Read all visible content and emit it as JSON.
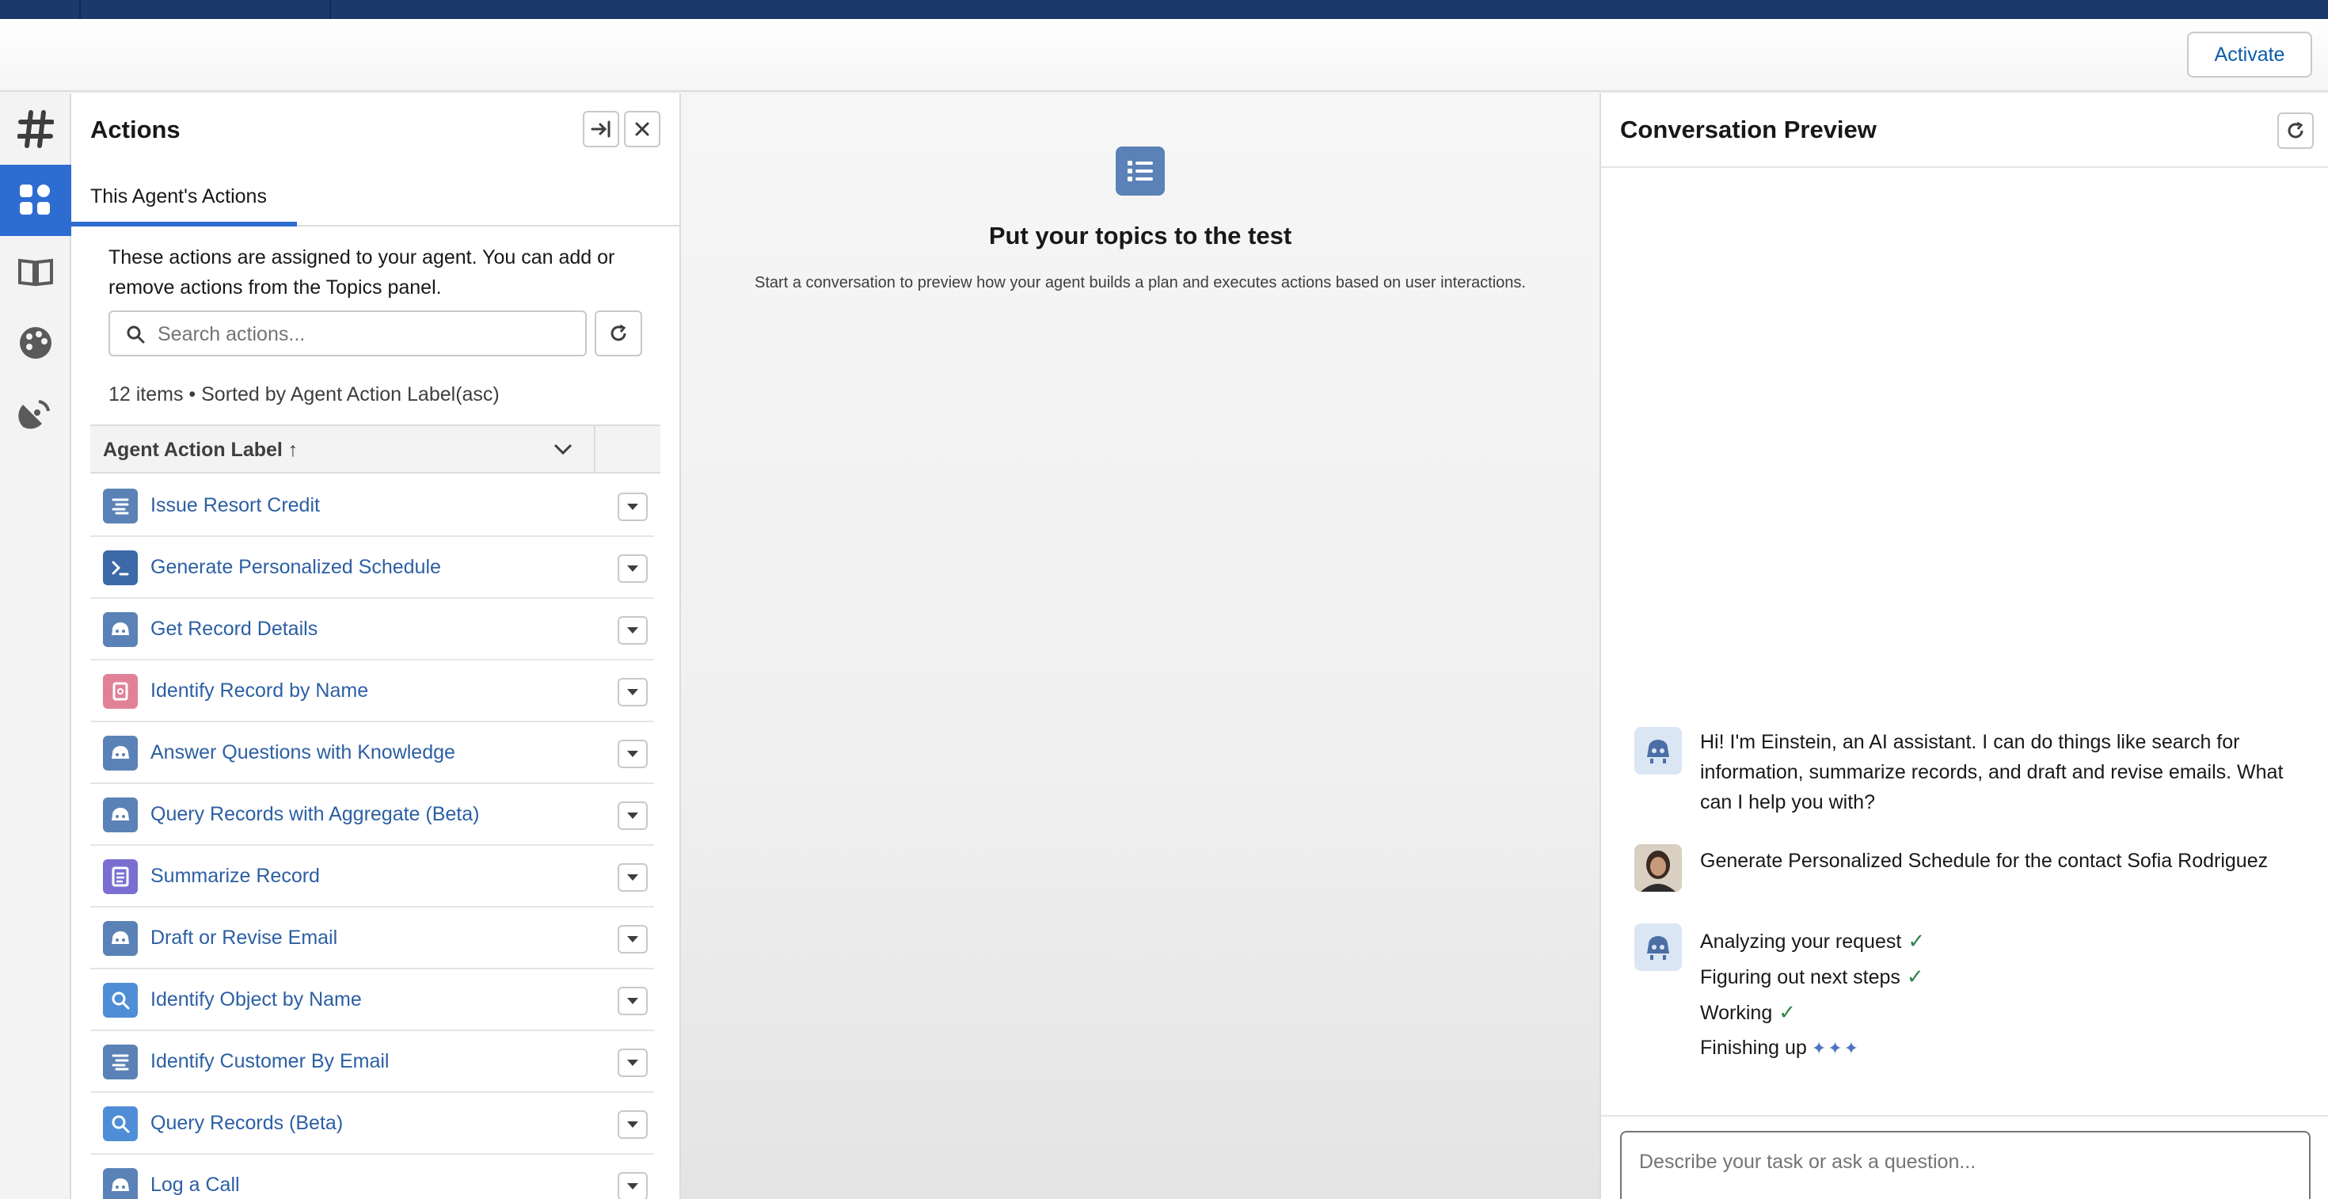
{
  "header": {
    "activate_label": "Activate"
  },
  "rail": {
    "items": [
      {
        "icon": "hash-icon",
        "active": false
      },
      {
        "icon": "grid-icon",
        "active": true
      },
      {
        "icon": "book-icon",
        "active": false
      },
      {
        "icon": "palette-icon",
        "active": false
      },
      {
        "icon": "satellite-icon",
        "active": false
      }
    ]
  },
  "actions": {
    "title": "Actions",
    "tab_label": "This Agent's Actions",
    "description": "These actions are assigned to your agent. You can add or remove actions from the Topics panel.",
    "search_placeholder": "Search actions...",
    "count_text": "12 items • Sorted by Agent Action Label(asc)",
    "column_header": "Agent Action Label ↑",
    "rows": [
      {
        "label": "Issue Resort Credit",
        "icon": "flow-icon",
        "color": "#5b82b6"
      },
      {
        "label": "Generate Personalized Schedule",
        "icon": "prompt-icon",
        "color": "#3c6aa8"
      },
      {
        "label": "Get Record Details",
        "icon": "einstein-icon",
        "color": "#5b82b6"
      },
      {
        "label": "Identify Record by Name",
        "icon": "record-icon",
        "color": "#e08198"
      },
      {
        "label": "Answer Questions with Knowledge",
        "icon": "einstein-icon",
        "color": "#5b82b6"
      },
      {
        "label": "Query Records with Aggregate (Beta)",
        "icon": "einstein-icon",
        "color": "#5b82b6"
      },
      {
        "label": "Summarize Record",
        "icon": "summary-icon",
        "color": "#7a6fd1"
      },
      {
        "label": "Draft or Revise Email",
        "icon": "einstein-icon",
        "color": "#5b82b6"
      },
      {
        "label": "Identify Object by Name",
        "icon": "search-icon",
        "color": "#4f8ed6"
      },
      {
        "label": "Identify Customer By Email",
        "icon": "flow-icon",
        "color": "#5b82b6"
      },
      {
        "label": "Query Records (Beta)",
        "icon": "search-icon",
        "color": "#4f8ed6"
      },
      {
        "label": "Log a Call",
        "icon": "einstein-icon",
        "color": "#5b82b6"
      }
    ]
  },
  "middle": {
    "title": "Put your topics to the test",
    "subtitle": "Start a conversation to preview how your agent builds a plan and executes actions based on user interactions."
  },
  "conversation": {
    "title": "Conversation Preview",
    "messages": [
      {
        "from": "bot",
        "text": "Hi! I'm Einstein, an AI assistant. I can do things like search for information, summarize records, and draft and revise emails. What can I help you with?"
      },
      {
        "from": "user",
        "text": "Generate Personalized Schedule for the contact Sofia Rodriguez"
      }
    ],
    "progress": [
      {
        "text": "Analyzing your request",
        "status": "done"
      },
      {
        "text": "Figuring out next steps",
        "status": "done"
      },
      {
        "text": "Working",
        "status": "done"
      },
      {
        "text": "Finishing up",
        "status": "in-progress"
      }
    ],
    "input_placeholder": "Describe your task or ask a question..."
  }
}
